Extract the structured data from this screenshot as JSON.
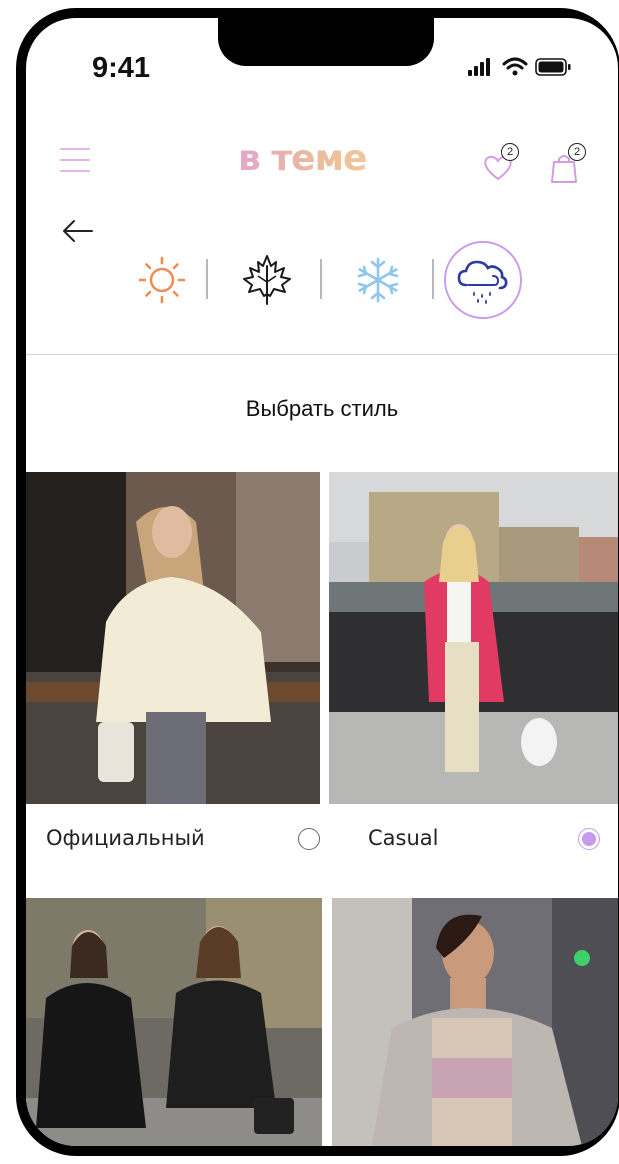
{
  "status_bar": {
    "time": "9:41"
  },
  "header": {
    "logo": "в теме",
    "favorites_count": "2",
    "cart_count": "2",
    "accent_color": "#c99bf0"
  },
  "seasons": [
    {
      "name": "summer",
      "icon": "sun-icon",
      "selected": false
    },
    {
      "name": "autumn",
      "icon": "maple-leaf-icon",
      "selected": false
    },
    {
      "name": "winter",
      "icon": "snowflake-icon",
      "selected": false
    },
    {
      "name": "rain",
      "icon": "rain-cloud-icon",
      "selected": true
    }
  ],
  "section_title": "Выбрать стиль",
  "styles": [
    {
      "label": "Официальный",
      "checked": false
    },
    {
      "label": "Casual",
      "checked": true
    }
  ]
}
